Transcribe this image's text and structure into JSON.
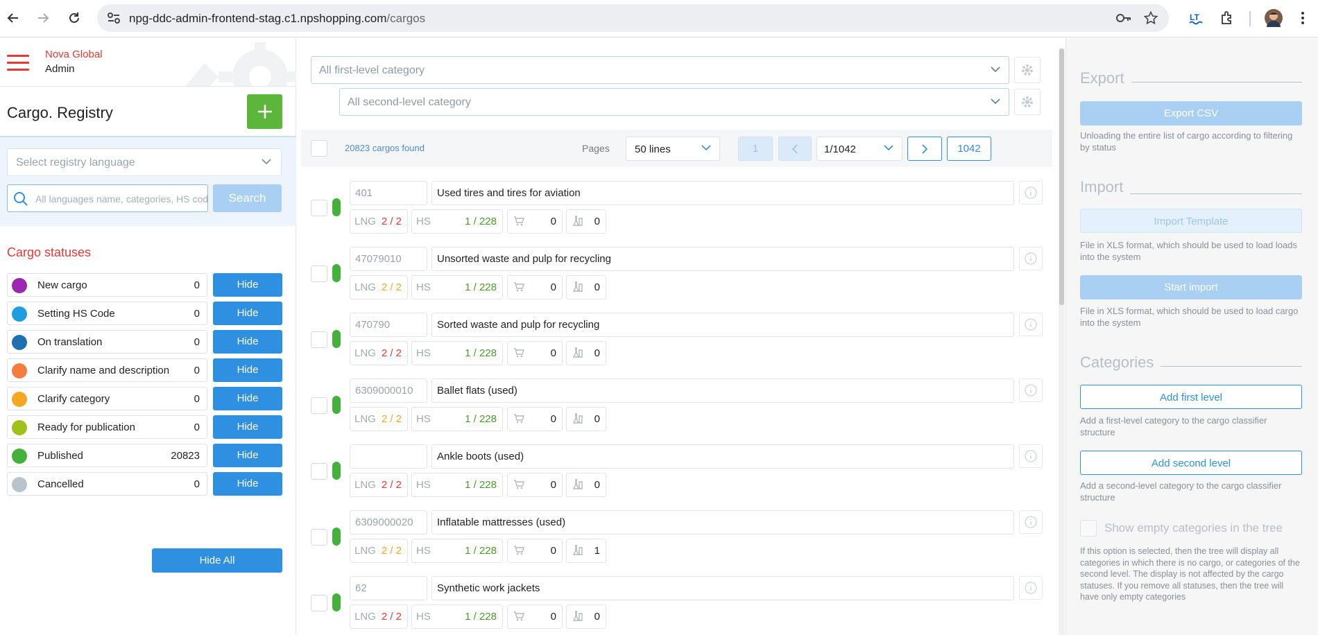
{
  "browser": {
    "url_host": "npg-ddc-admin-frontend-stag.c1.npshopping.com",
    "url_path": "/cargos"
  },
  "brand": {
    "line1": "Nova Global",
    "line2": "Admin"
  },
  "registry": {
    "title": "Cargo. Registry",
    "language_placeholder": "Select registry language",
    "search_placeholder": "All languages name, categories, HS code",
    "search_button": "Search"
  },
  "statuses": {
    "title": "Cargo statuses",
    "hide_label": "Hide",
    "hide_all": "Hide All",
    "items": [
      {
        "label": "New cargo",
        "count": "0",
        "color": "#9c27b0"
      },
      {
        "label": "Setting HS Code",
        "count": "0",
        "color": "#1e9ee0"
      },
      {
        "label": "On translation",
        "count": "0",
        "color": "#1f6fb3"
      },
      {
        "label": "Clarify name and description",
        "count": "0",
        "color": "#f57c3c"
      },
      {
        "label": "Clarify category",
        "count": "0",
        "color": "#f5a623"
      },
      {
        "label": "Ready for publication",
        "count": "0",
        "color": "#a0c11a"
      },
      {
        "label": "Published",
        "count": "20823",
        "color": "#44b23a"
      },
      {
        "label": "Cancelled",
        "count": "0",
        "color": "#b8c3cc"
      }
    ]
  },
  "filters": {
    "first_level": "All first-level category",
    "second_level": "All second-level category"
  },
  "toolbar": {
    "found": "20823 cargos found",
    "pages_label": "Pages",
    "lines": "50 lines",
    "first_page": "1",
    "page_select": "1/1042",
    "last_page": "1042"
  },
  "cargos": [
    {
      "code": "401",
      "name": "Used tires and tires for aviation",
      "lng": "2 / 2",
      "lng_color": "#e53935",
      "hs": "1 / 228",
      "cart": "0",
      "lab": "0"
    },
    {
      "code": "47079010",
      "name": "Unsorted waste and pulp for recycling",
      "lng": "2 / 2",
      "lng_color": "#f5a623",
      "hs": "1 / 228",
      "cart": "0",
      "lab": "0"
    },
    {
      "code": "470790",
      "name": "Sorted waste and pulp for recycling",
      "lng": "2 / 2",
      "lng_color": "#e53935",
      "hs": "1 / 228",
      "cart": "0",
      "lab": "0"
    },
    {
      "code": "6309000010",
      "name": "Ballet flats (used)",
      "lng": "2 / 2",
      "lng_color": "#f5a623",
      "hs": "1 / 228",
      "cart": "0",
      "lab": "0"
    },
    {
      "code": "",
      "name": "Ankle boots (used)",
      "lng": "2 / 2",
      "lng_color": "#e53935",
      "hs": "1 / 228",
      "cart": "0",
      "lab": "0"
    },
    {
      "code": "6309000020",
      "name": "Inflatable mattresses (used)",
      "lng": "2 / 2",
      "lng_color": "#f5a623",
      "hs": "1 / 228",
      "cart": "0",
      "lab": "1"
    },
    {
      "code": "62",
      "name": "Synthetic work jackets",
      "lng": "2 / 2",
      "lng_color": "#e53935",
      "hs": "1 / 228",
      "cart": "0",
      "lab": "0"
    }
  ],
  "labels": {
    "lng": "LNG",
    "hs": "HS",
    "hs_color": "#4a9a2a"
  },
  "right": {
    "export_title": "Export",
    "export_csv": "Export CSV",
    "export_help": "Unloading the entire list of cargo according to filtering by status",
    "import_title": "Import",
    "import_template": "Import Template",
    "import_template_help": "File in XLS format, which should be used to load loads into the system",
    "start_import": "Start import",
    "start_import_help": "File in XLS format, which should be used to load cargo into the system",
    "categories_title": "Categories",
    "add_first": "Add first level",
    "add_first_help": "Add a first-level category to the cargo classifier structure",
    "add_second": "Add second level",
    "add_second_help": "Add a second-level category to the cargo classifier structure",
    "show_empty": "Show empty categories in the tree",
    "show_empty_help": "If this option is selected, then the tree will display all categories in which there is no cargo, or categories of the second level. The display is not affected by the cargo statuses. If you remove all statuses, then the tree will have only empty categories"
  }
}
